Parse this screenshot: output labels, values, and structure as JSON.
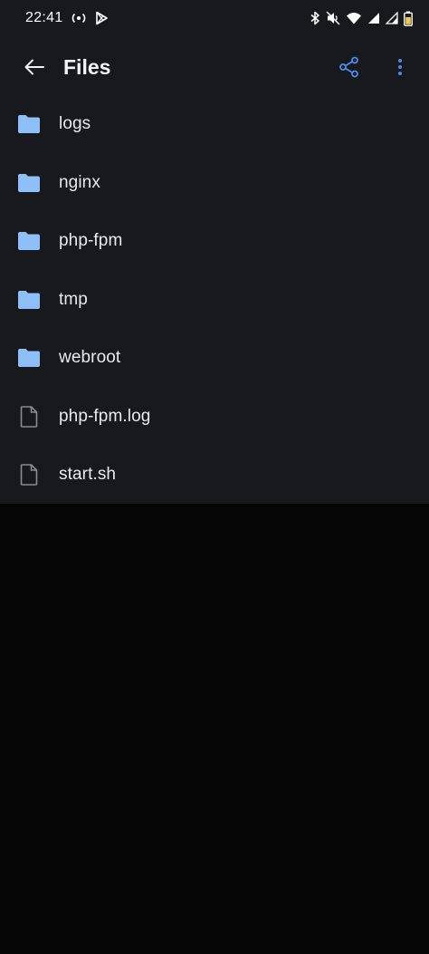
{
  "status_bar": {
    "time": "22:41"
  },
  "app_bar": {
    "title": "Files"
  },
  "colors": {
    "accent": "#4a8df2",
    "folder": "#8fbff7",
    "file_outline": "#8a8c92",
    "surface": "#18191d",
    "background": "#050506"
  },
  "files": [
    {
      "name": "logs",
      "type": "folder"
    },
    {
      "name": "nginx",
      "type": "folder"
    },
    {
      "name": "php-fpm",
      "type": "folder"
    },
    {
      "name": "tmp",
      "type": "folder"
    },
    {
      "name": "webroot",
      "type": "folder"
    },
    {
      "name": "php-fpm.log",
      "type": "file"
    },
    {
      "name": "start.sh",
      "type": "file"
    }
  ],
  "icons": {
    "back": "arrow-left-icon",
    "share": "share-icon",
    "more": "more-vertical-icon",
    "folder": "folder-icon",
    "file": "file-icon"
  }
}
